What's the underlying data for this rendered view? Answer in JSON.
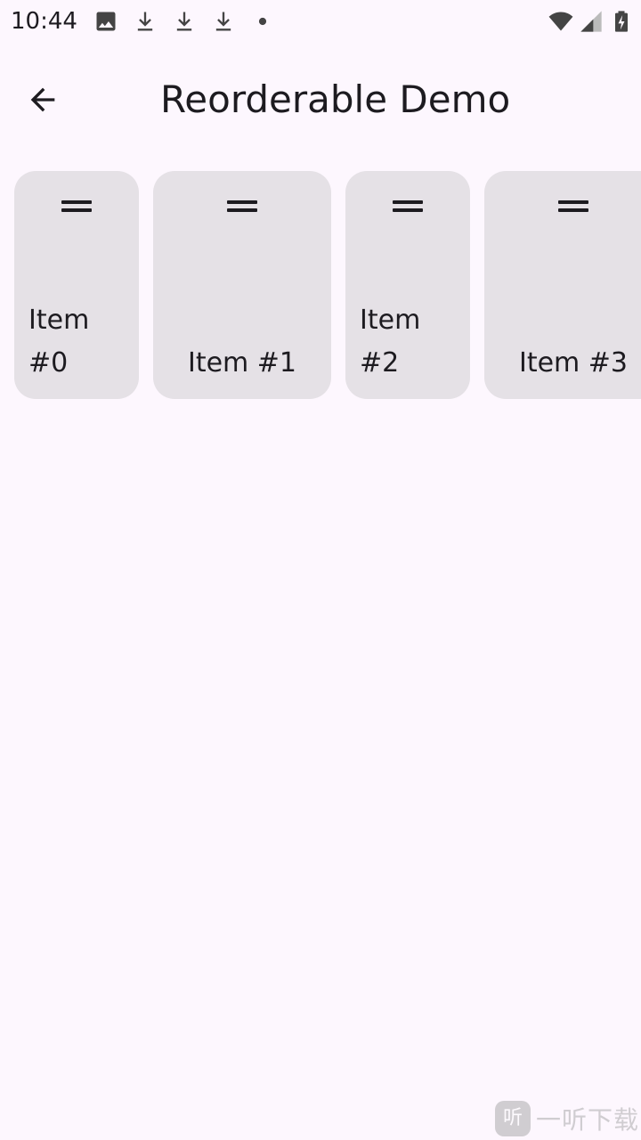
{
  "status_bar": {
    "time": "10:44",
    "left_icons": [
      "image-icon",
      "download-icon",
      "download-icon",
      "download-icon",
      "dot-icon"
    ],
    "right_icons": [
      "wifi-icon",
      "signal-icon",
      "battery-charging-icon"
    ]
  },
  "app_bar": {
    "back_icon": "arrow-back-icon",
    "title": "Reorderable Demo"
  },
  "items": [
    {
      "label": "Item #0",
      "handle_icon": "drag-handle-icon"
    },
    {
      "label": "Item #1",
      "handle_icon": "drag-handle-icon"
    },
    {
      "label": "Item #2",
      "handle_icon": "drag-handle-icon"
    },
    {
      "label": "Item #3",
      "handle_icon": "drag-handle-icon"
    }
  ],
  "watermark": {
    "logo": "听",
    "text": "一听下载"
  },
  "colors": {
    "background": "#fdf7fe",
    "card": "#e5e1e6",
    "text": "#1d1b20"
  }
}
